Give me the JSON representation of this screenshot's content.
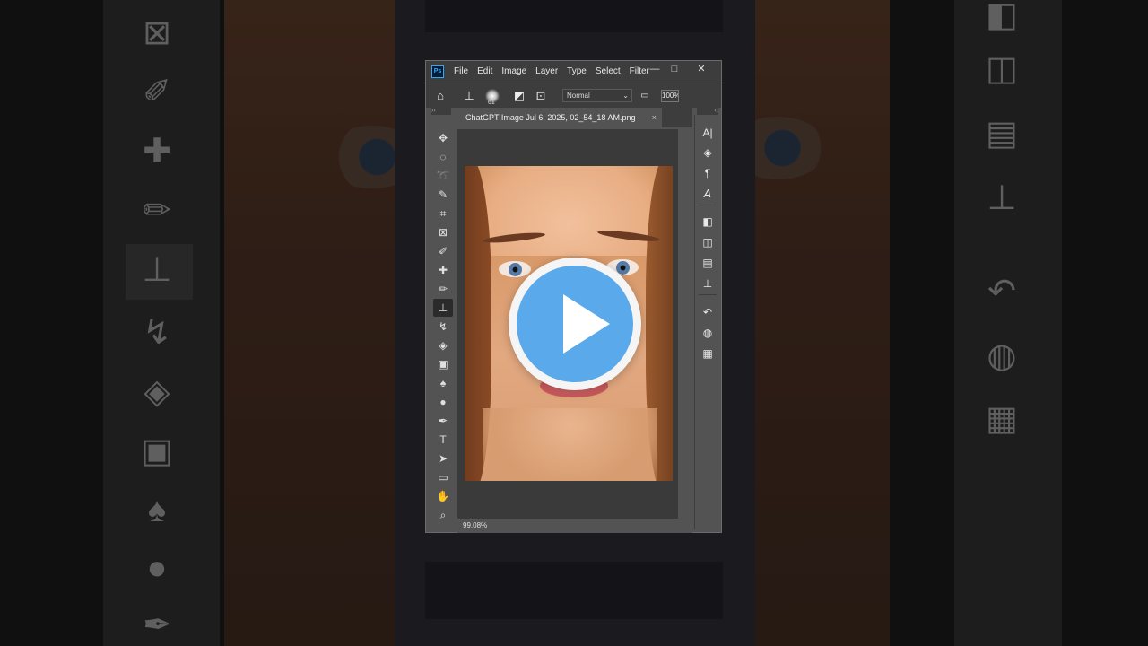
{
  "app": {
    "logo": "Ps",
    "menu": [
      "File",
      "Edit",
      "Image",
      "Layer",
      "Type",
      "Select",
      "Filter"
    ],
    "window_controls": {
      "minimize": "—",
      "maximize": "□",
      "close": "✕"
    }
  },
  "options_bar": {
    "brush_size": "61",
    "blend_mode": "Normal",
    "opacity": "100%"
  },
  "document": {
    "tab_title": "ChatGPT Image Jul 6, 2025, 02_54_18 AM.png",
    "close": "×",
    "zoom": "99.08%"
  },
  "tools": [
    {
      "name": "move-tool-icon",
      "glyph": "✥"
    },
    {
      "name": "marquee-tool-icon",
      "glyph": "◌"
    },
    {
      "name": "lasso-tool-icon",
      "glyph": "➰"
    },
    {
      "name": "quick-select-tool-icon",
      "glyph": "✎"
    },
    {
      "name": "crop-tool-icon",
      "glyph": "⌗"
    },
    {
      "name": "frame-tool-icon",
      "glyph": "⊠"
    },
    {
      "name": "eyedropper-tool-icon",
      "glyph": "✐"
    },
    {
      "name": "healing-brush-tool-icon",
      "glyph": "✚"
    },
    {
      "name": "brush-tool-icon",
      "glyph": "✏"
    },
    {
      "name": "clone-stamp-tool-icon",
      "glyph": "⊥"
    },
    {
      "name": "history-brush-tool-icon",
      "glyph": "↯"
    },
    {
      "name": "eraser-tool-icon",
      "glyph": "◈"
    },
    {
      "name": "gradient-tool-icon",
      "glyph": "▣"
    },
    {
      "name": "blur-tool-icon",
      "glyph": "♠"
    },
    {
      "name": "dodge-tool-icon",
      "glyph": "●"
    },
    {
      "name": "pen-tool-icon",
      "glyph": "✒"
    },
    {
      "name": "type-tool-icon",
      "glyph": "T"
    },
    {
      "name": "path-select-tool-icon",
      "glyph": "➤"
    },
    {
      "name": "rectangle-tool-icon",
      "glyph": "▭"
    },
    {
      "name": "hand-tool-icon",
      "glyph": "✋"
    },
    {
      "name": "zoom-tool-icon",
      "glyph": "⌕"
    }
  ],
  "right_panel": [
    {
      "name": "character-panel-icon",
      "glyph": "A|"
    },
    {
      "name": "layers-panel-icon",
      "glyph": "◈"
    },
    {
      "name": "paragraph-panel-icon",
      "glyph": "¶"
    },
    {
      "name": "glyphs-panel-icon",
      "glyph": "𝘈"
    },
    {
      "name": "adjustments-panel-icon",
      "glyph": "◧"
    },
    {
      "name": "libraries-panel-icon",
      "glyph": "◫"
    },
    {
      "name": "properties-panel-icon",
      "glyph": "▤"
    },
    {
      "name": "clone-source-panel-icon",
      "glyph": "⊥"
    },
    {
      "name": "history-panel-icon",
      "glyph": "↶"
    },
    {
      "name": "color-panel-icon",
      "glyph": "◍"
    },
    {
      "name": "swatches-panel-icon",
      "glyph": "▦"
    }
  ],
  "colors": {
    "play_button": "#5aa9ea",
    "ps_chrome": "#3d3d3d",
    "ps_panel": "#535353"
  }
}
